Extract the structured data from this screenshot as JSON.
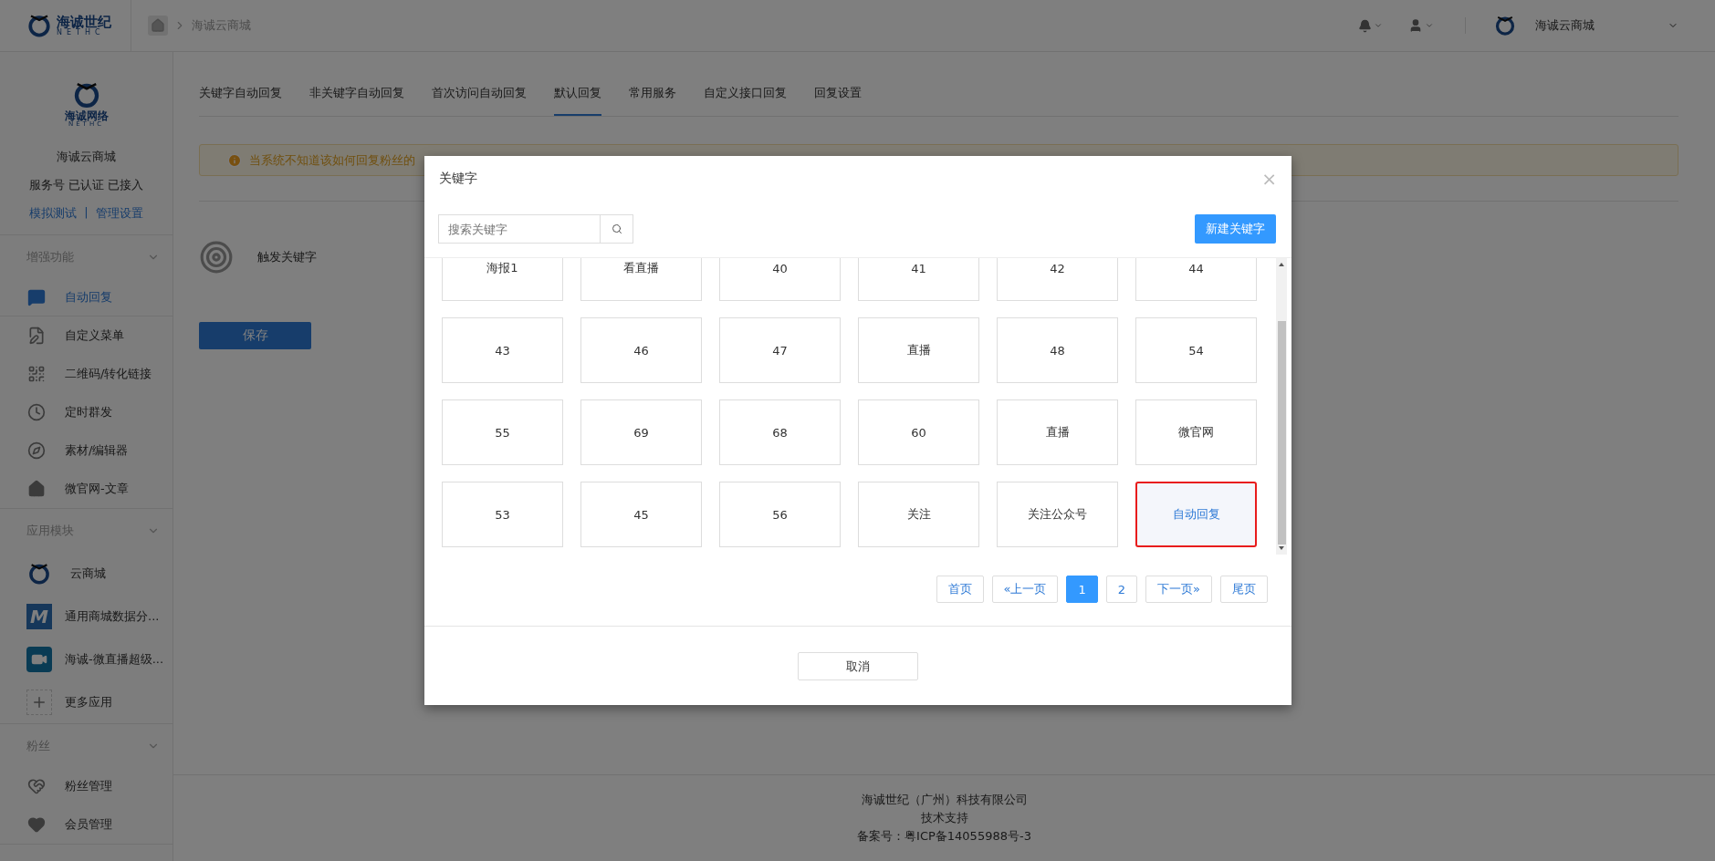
{
  "header": {
    "logo": {
      "name": "海诚世纪",
      "sub": "NETHC"
    },
    "breadcrumb": "海诚云商城",
    "account": "海诚云商城"
  },
  "sidebar": {
    "logo": {
      "name": "海诚网络",
      "sub": "NETHC"
    },
    "account_name": "海诚云商城",
    "status": "服务号 已认证 已接入",
    "links": [
      "模拟测试",
      "管理设置"
    ],
    "link_separator": "|",
    "sections": [
      {
        "title": "增强功能",
        "items": [
          {
            "label": "自动回复",
            "kind": "chat",
            "selected": true
          },
          {
            "label": "自定义菜单",
            "kind": "doc",
            "selected": false
          },
          {
            "label": "二维码/转化链接",
            "kind": "qr",
            "selected": false
          },
          {
            "label": "定时群发",
            "kind": "clock",
            "selected": false
          },
          {
            "label": "素材/编辑器",
            "kind": "pen",
            "selected": false
          },
          {
            "label": "微官网-文章",
            "kind": "home",
            "selected": false
          }
        ]
      },
      {
        "title": "应用模块",
        "items": [
          {
            "label": "云商城",
            "kind": "ring",
            "selected": false
          },
          {
            "label": "通用商城数据分...",
            "kind": "letter",
            "icon_text": "M",
            "selected": false
          },
          {
            "label": "海诚-微直播超级...",
            "kind": "video",
            "selected": false
          },
          {
            "label": "更多应用",
            "kind": "plus",
            "selected": false
          }
        ]
      },
      {
        "title": "粉丝",
        "items": [
          {
            "label": "粉丝管理",
            "kind": "heart-edit",
            "selected": false
          },
          {
            "label": "会员管理",
            "kind": "heart",
            "selected": false
          }
        ]
      }
    ]
  },
  "tabs": [
    {
      "label": "关键字自动回复",
      "selected": false
    },
    {
      "label": "非关键字自动回复",
      "selected": false
    },
    {
      "label": "首次访问自动回复",
      "selected": false
    },
    {
      "label": "默认回复",
      "selected": true
    },
    {
      "label": "常用服务",
      "selected": false
    },
    {
      "label": "自定义接口回复",
      "selected": false
    },
    {
      "label": "回复设置",
      "selected": false
    }
  ],
  "alert": "当系统不知道该如何回复粉丝的",
  "trigger_label": "触发关键字",
  "save_button": "保存",
  "footer": [
    "海诚世纪（广州）科技有限公司",
    "技术支持",
    "备案号：粤ICP备14055988号-3"
  ],
  "dialog": {
    "title": "关键字",
    "close": "×",
    "search": {
      "placeholder": "搜索关键字"
    },
    "new_button": "新建关键字",
    "keywords": [
      {
        "label": "海报1",
        "selected": false
      },
      {
        "label": "看直播",
        "selected": false
      },
      {
        "label": "40",
        "selected": false
      },
      {
        "label": "41",
        "selected": false
      },
      {
        "label": "42",
        "selected": false
      },
      {
        "label": "44",
        "selected": false
      },
      {
        "label": "43",
        "selected": false
      },
      {
        "label": "46",
        "selected": false
      },
      {
        "label": "47",
        "selected": false
      },
      {
        "label": "直播",
        "selected": false
      },
      {
        "label": "48",
        "selected": false
      },
      {
        "label": "54",
        "selected": false
      },
      {
        "label": "55",
        "selected": false
      },
      {
        "label": "69",
        "selected": false
      },
      {
        "label": "68",
        "selected": false
      },
      {
        "label": "60",
        "selected": false
      },
      {
        "label": "直播",
        "selected": false
      },
      {
        "label": "微官网",
        "selected": false
      },
      {
        "label": "53",
        "selected": false
      },
      {
        "label": "45",
        "selected": false
      },
      {
        "label": "56",
        "selected": false
      },
      {
        "label": "关注",
        "selected": false
      },
      {
        "label": "关注公众号",
        "selected": false
      },
      {
        "label": "自动回复",
        "selected": true
      }
    ],
    "pagination": [
      {
        "label": "首页",
        "selected": false
      },
      {
        "label": "«上一页",
        "selected": false
      },
      {
        "label": "1",
        "selected": true
      },
      {
        "label": "2",
        "selected": false
      },
      {
        "label": "下一页»",
        "selected": false
      },
      {
        "label": "尾页",
        "selected": false
      }
    ],
    "cancel_button": "取消"
  }
}
